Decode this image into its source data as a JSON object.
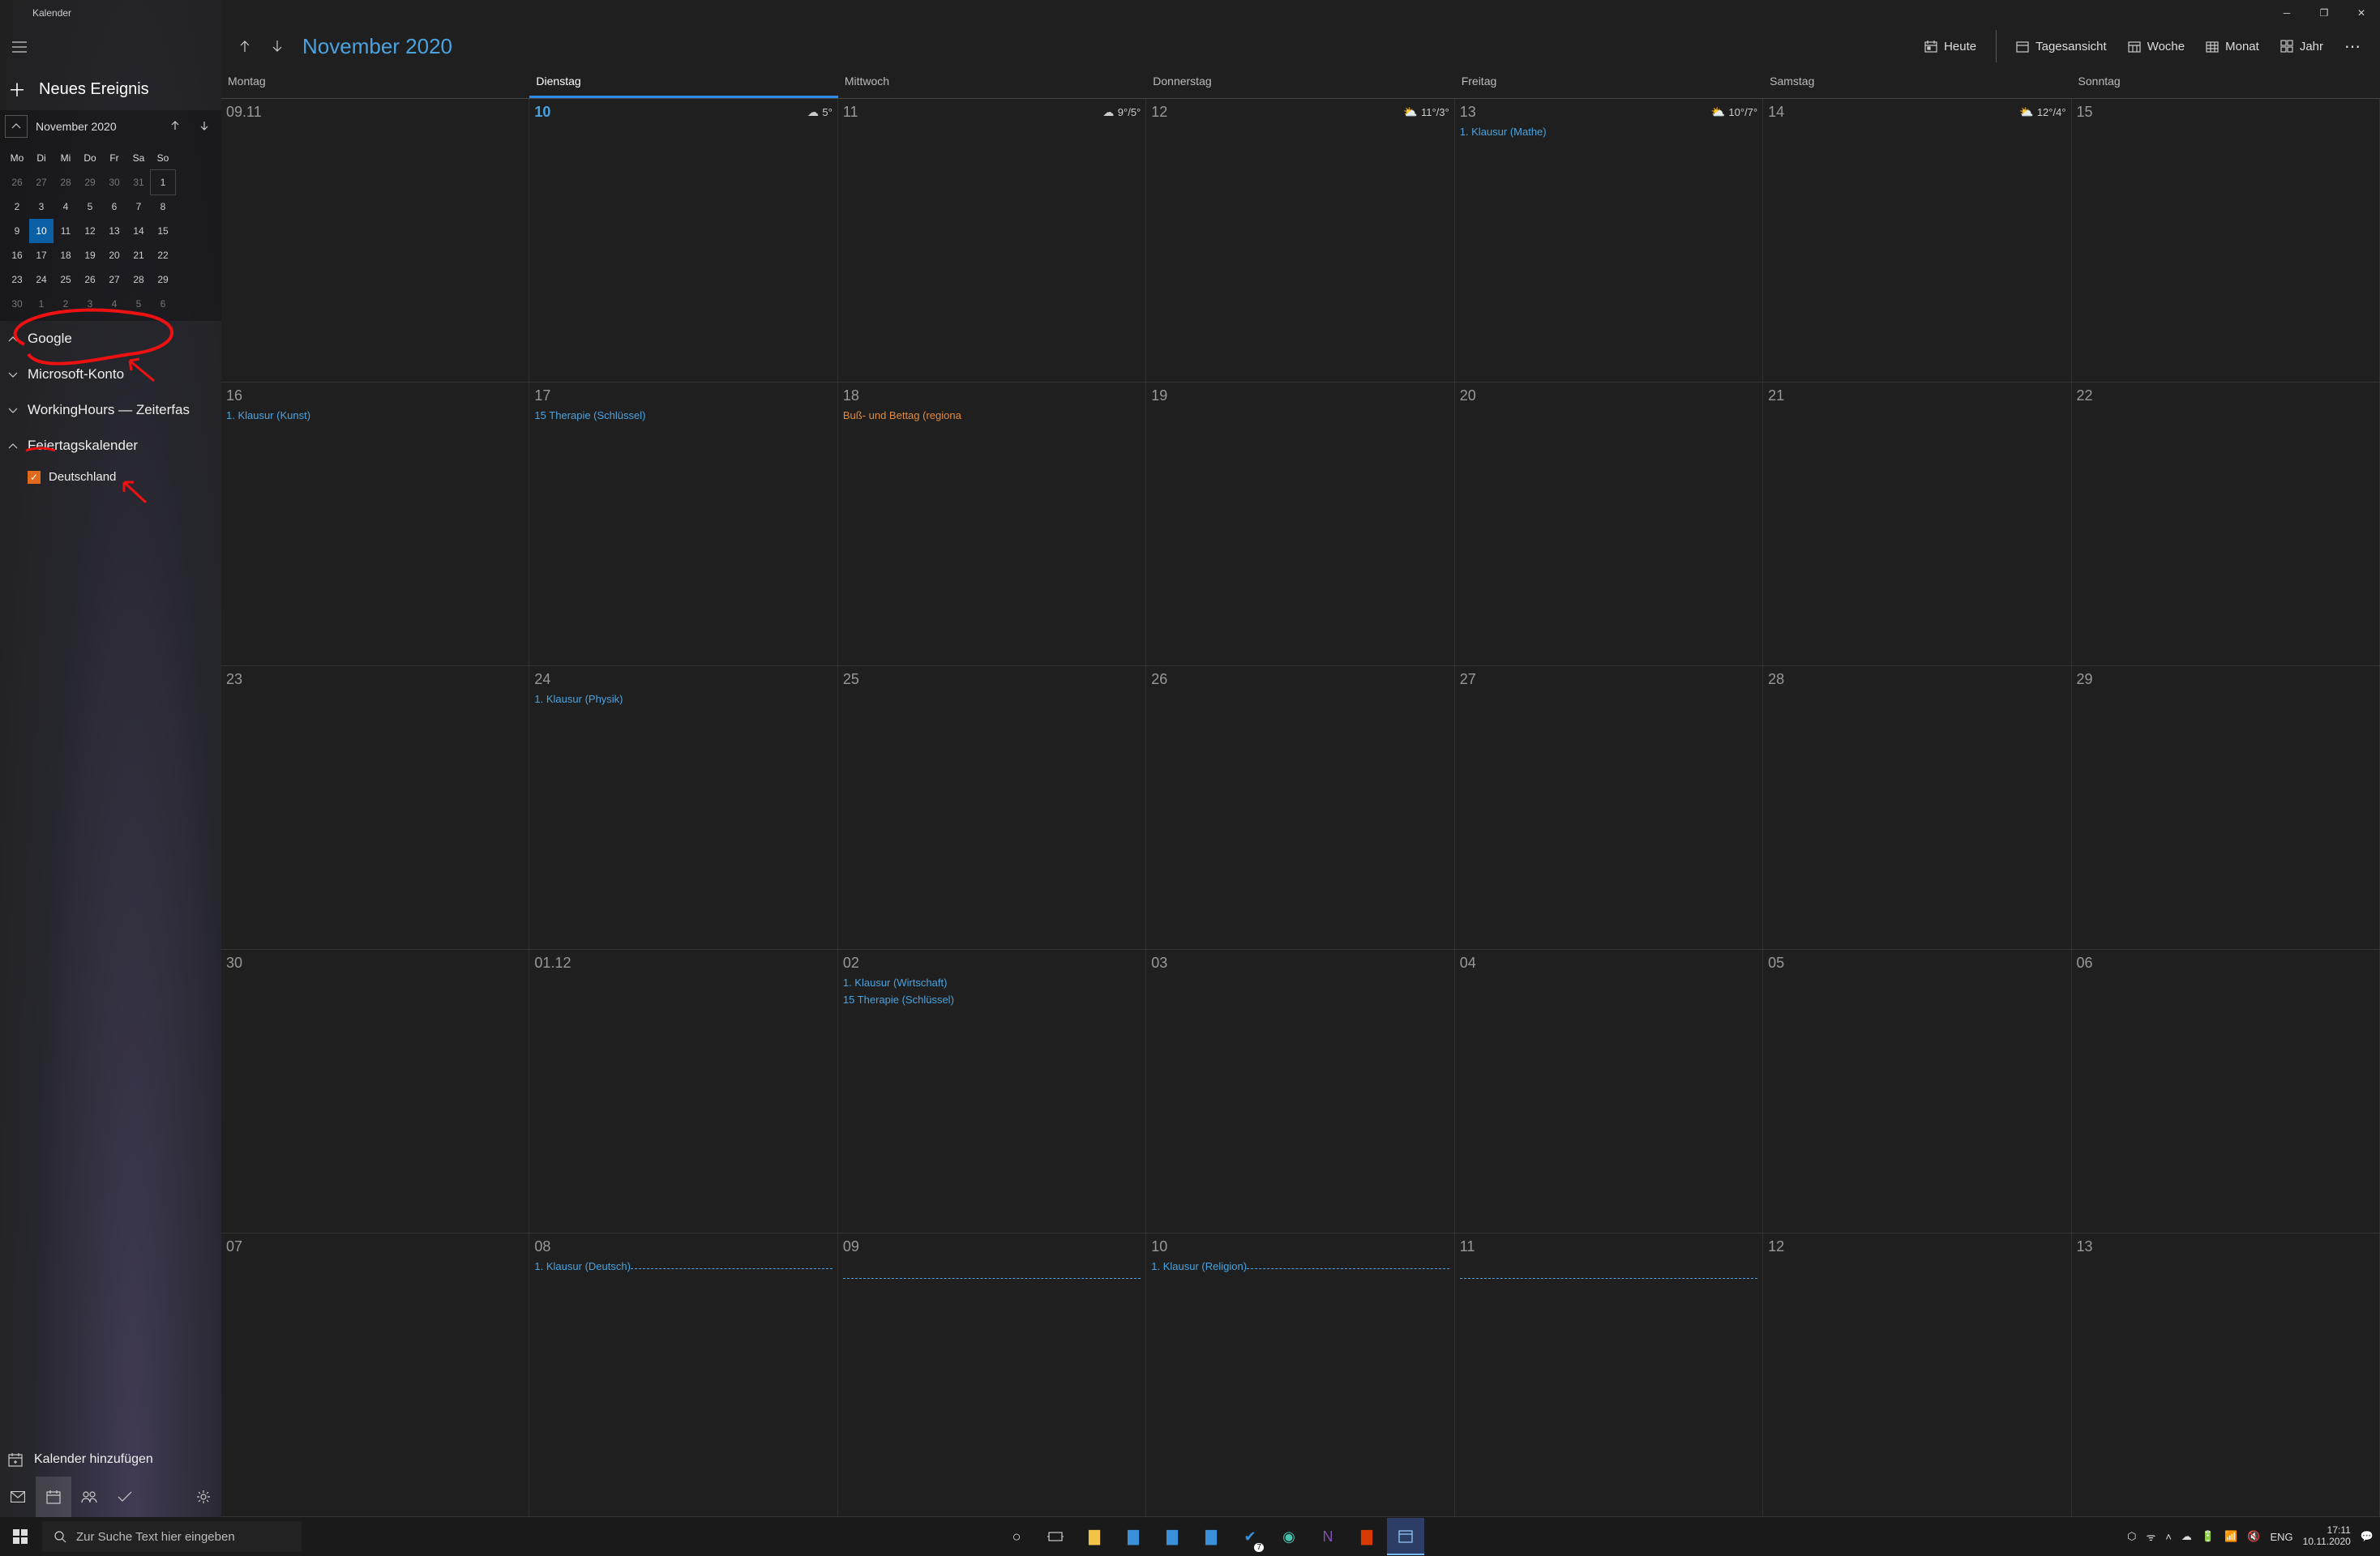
{
  "window": {
    "title": "Kalender"
  },
  "sidebar": {
    "new_event": "Neues Ereignis",
    "mini": {
      "month": "November 2020",
      "dow": [
        "Mo",
        "Di",
        "Mi",
        "Do",
        "Fr",
        "Sa",
        "So"
      ],
      "rows": [
        [
          {
            "n": "26",
            "dim": true
          },
          {
            "n": "27",
            "dim": true
          },
          {
            "n": "28",
            "dim": true
          },
          {
            "n": "29",
            "dim": true
          },
          {
            "n": "30",
            "dim": true
          },
          {
            "n": "31",
            "dim": true
          },
          {
            "n": "1",
            "box": true
          }
        ],
        [
          {
            "n": "2"
          },
          {
            "n": "3"
          },
          {
            "n": "4"
          },
          {
            "n": "5"
          },
          {
            "n": "6"
          },
          {
            "n": "7"
          },
          {
            "n": "8"
          }
        ],
        [
          {
            "n": "9"
          },
          {
            "n": "10",
            "today": true
          },
          {
            "n": "11"
          },
          {
            "n": "12"
          },
          {
            "n": "13"
          },
          {
            "n": "14"
          },
          {
            "n": "15"
          }
        ],
        [
          {
            "n": "16"
          },
          {
            "n": "17"
          },
          {
            "n": "18"
          },
          {
            "n": "19"
          },
          {
            "n": "20"
          },
          {
            "n": "21"
          },
          {
            "n": "22"
          }
        ],
        [
          {
            "n": "23"
          },
          {
            "n": "24"
          },
          {
            "n": "25"
          },
          {
            "n": "26"
          },
          {
            "n": "27"
          },
          {
            "n": "28"
          },
          {
            "n": "29"
          }
        ],
        [
          {
            "n": "30",
            "dim": true
          },
          {
            "n": "1",
            "dim": true
          },
          {
            "n": "2",
            "dim": true
          },
          {
            "n": "3",
            "dim": true
          },
          {
            "n": "4",
            "dim": true
          },
          {
            "n": "5",
            "dim": true
          },
          {
            "n": "6",
            "dim": true
          }
        ]
      ]
    },
    "accounts": [
      {
        "label": "Google",
        "expanded": true
      },
      {
        "label": "Microsoft-Konto",
        "expanded": false
      },
      {
        "label": "WorkingHours — Zeiterfas",
        "expanded": false
      },
      {
        "label": "Feiertagskalender",
        "expanded": true,
        "subs": [
          {
            "label": "Deutschland",
            "checked": true,
            "color": "#e06a1b"
          }
        ]
      }
    ],
    "add_calendar": "Kalender hinzufügen"
  },
  "toolbar": {
    "month_title": "November 2020",
    "heute": "Heute",
    "views": [
      "Tagesansicht",
      "Woche",
      "Monat",
      "Jahr"
    ]
  },
  "day_headers": [
    "Montag",
    "Dienstag",
    "Mittwoch",
    "Donnerstag",
    "Freitag",
    "Samstag",
    "Sonntag"
  ],
  "today_index": 1,
  "weeks": [
    [
      {
        "num": "09.11"
      },
      {
        "num": "10",
        "today": true,
        "weather": {
          "icon": "☁",
          "text": "5°"
        }
      },
      {
        "num": "11",
        "weather": {
          "icon": "☁",
          "text": "9°/5°"
        }
      },
      {
        "num": "12",
        "weather": {
          "icon": "⛅",
          "text": "11°/3°"
        }
      },
      {
        "num": "13",
        "weather": {
          "icon": "⛅",
          "text": "10°/7°"
        },
        "events": [
          {
            "text": "1. Klausur (Mathe)"
          }
        ]
      },
      {
        "num": "14",
        "weather": {
          "icon": "⛅",
          "text": "12°/4°"
        }
      },
      {
        "num": "15"
      }
    ],
    [
      {
        "num": "16",
        "events": [
          {
            "text": "1. Klausur (Kunst)"
          }
        ]
      },
      {
        "num": "17",
        "events": [
          {
            "text": "15 Therapie (Schlüssel)"
          }
        ]
      },
      {
        "num": "18",
        "events": [
          {
            "text": "Buß- und Bettag (regiona",
            "cls": "orange"
          }
        ]
      },
      {
        "num": "19"
      },
      {
        "num": "20"
      },
      {
        "num": "21"
      },
      {
        "num": "22"
      }
    ],
    [
      {
        "num": "23"
      },
      {
        "num": "24",
        "events": [
          {
            "text": "1. Klausur (Physik)"
          }
        ]
      },
      {
        "num": "25"
      },
      {
        "num": "26"
      },
      {
        "num": "27"
      },
      {
        "num": "28"
      },
      {
        "num": "29"
      }
    ],
    [
      {
        "num": "30"
      },
      {
        "num": "01.12"
      },
      {
        "num": "02",
        "events": [
          {
            "text": "1. Klausur (Wirtschaft)"
          },
          {
            "text": "15 Therapie (Schlüssel)"
          }
        ]
      },
      {
        "num": "03"
      },
      {
        "num": "04"
      },
      {
        "num": "05"
      },
      {
        "num": "06"
      }
    ],
    [
      {
        "num": "07"
      },
      {
        "num": "08",
        "span_event": {
          "text": "1. Klausur (Deutsch)",
          "dash": true
        }
      },
      {
        "num": "09",
        "span_continue": true
      },
      {
        "num": "10",
        "span_event": {
          "text": "1. Klausur (Religion)",
          "dash": true
        }
      },
      {
        "num": "11",
        "span_continue": true
      },
      {
        "num": "12"
      },
      {
        "num": "13"
      }
    ]
  ],
  "taskbar": {
    "search_placeholder": "Zur Suche Text hier eingeben",
    "lang": "ENG",
    "time": "17:11",
    "date": "10.11.2020",
    "todo_badge": "7"
  }
}
